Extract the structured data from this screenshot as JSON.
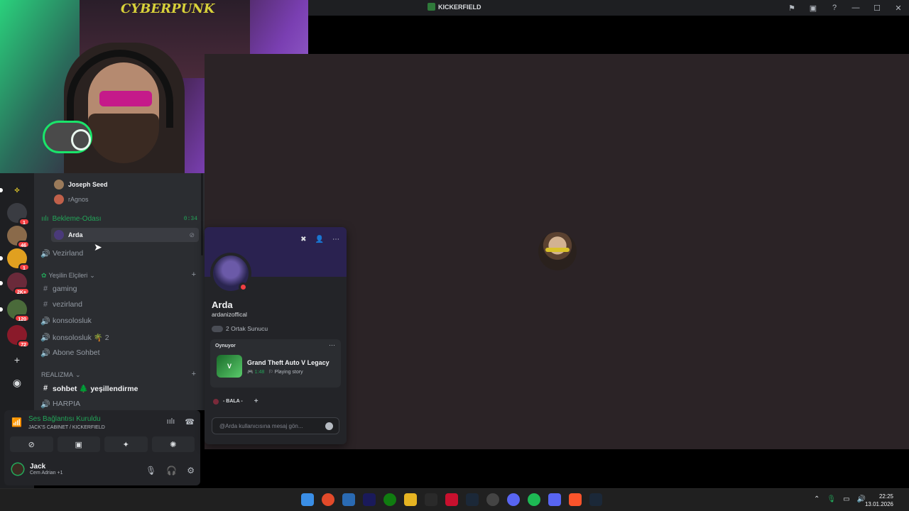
{
  "window": {
    "title": "KICKERFIELD",
    "icons": [
      "flag-icon",
      "screen-share-icon",
      "help-icon"
    ],
    "controls": [
      "—",
      "☐",
      "✕"
    ]
  },
  "rail": {
    "badges": [
      "1",
      "46",
      "1",
      "2K+",
      "120",
      "72"
    ]
  },
  "channels": {
    "members_top": [
      {
        "name": "Joseph Seed"
      },
      {
        "name": "rAgnos"
      }
    ],
    "voice_channel": {
      "name": "Bekleme-Odası",
      "time": "0:34",
      "member": "Arda"
    },
    "vezirland_voice": "Vezirland",
    "category1": "Yeşilin Elçileri",
    "cat1_items": [
      {
        "icon": "#",
        "label": "gaming"
      },
      {
        "icon": "#",
        "label": "vezirland"
      },
      {
        "icon": "🔊",
        "label": "konsolosluk"
      },
      {
        "icon": "🔊",
        "label": "konsolosluk 🌴 2"
      },
      {
        "icon": "🔊",
        "label": "Abone Sohbet"
      }
    ],
    "category2": "REALIZMA",
    "cat2_items": [
      {
        "icon": "#",
        "label": "sohbet 🌲 yeşillendirme"
      },
      {
        "icon": "🔊",
        "label": "HARPIA"
      }
    ]
  },
  "voice_panel": {
    "status": "Ses Bağlantısı Kuruldu",
    "location": "JACK'S CABINET / KICKERFIELD",
    "user_name": "Jack",
    "user_status": "Cem Adrian +1"
  },
  "profile": {
    "name": "Arda",
    "username": "ardanizoffical",
    "mutual": "2 Ortak Sunucu",
    "activity_label": "Oynuyor",
    "game": "Grand Theft Auto V Legacy",
    "game_icon": "V",
    "game_time": "1:48",
    "game_state": "Playing story",
    "role": "- BALA -",
    "message_placeholder": "@Arda kullanıcısına mesaj gön..."
  },
  "clock": {
    "time": "22:25",
    "date": "13.01.2026"
  },
  "colors": {
    "accent_green": "#23a559",
    "dnd_red": "#f23f43",
    "banner": "#2a2250"
  }
}
